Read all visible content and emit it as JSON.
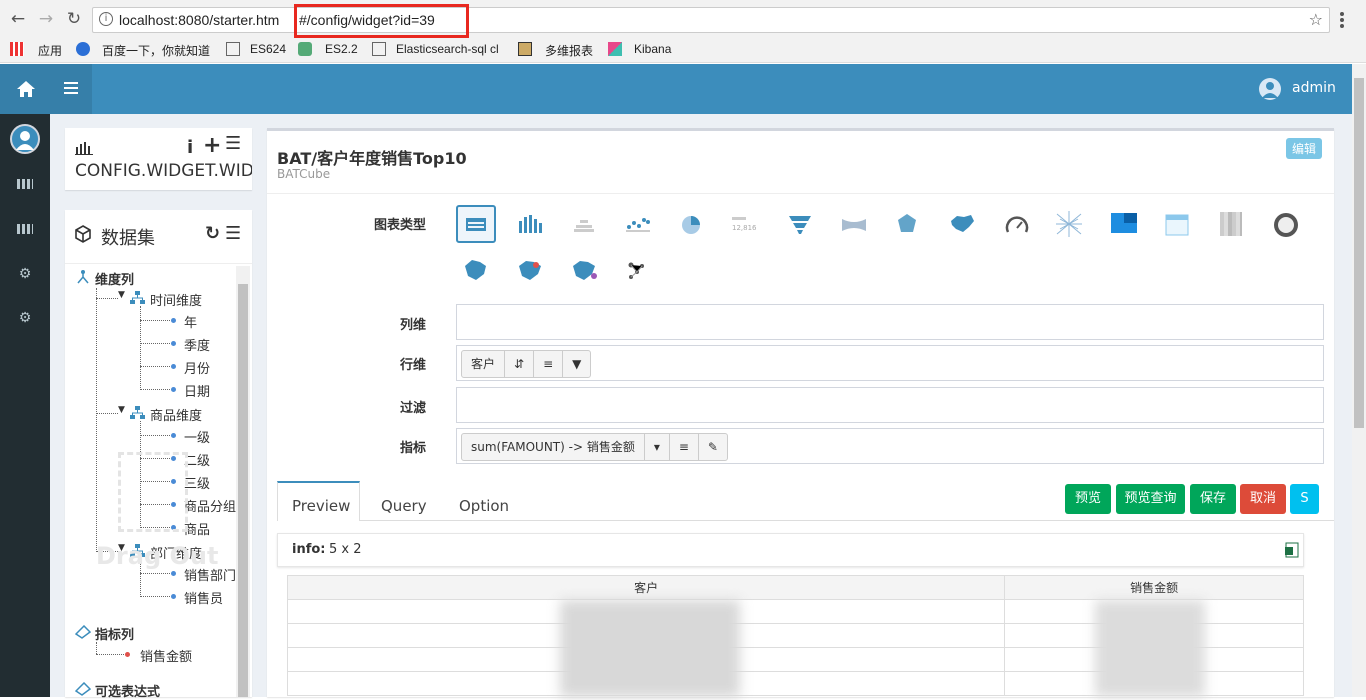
{
  "browser": {
    "url_host_path": "localhost:8080/starter.htm",
    "url_hash": "#/config/widget?id=39",
    "bookmarks": [
      "应用",
      "百度一下，你就知道",
      "ES624",
      "ES2.2",
      "Elasticsearch-sql cl",
      "多维报表",
      "Kibana"
    ]
  },
  "header": {
    "user": "admin"
  },
  "widget_list_box": {
    "title": "CONFIG.WIDGET.WIDG"
  },
  "dataset_box": {
    "title": "数据集",
    "dimension_header": "维度列",
    "groups": [
      {
        "label": "时间维度",
        "items": [
          "年",
          "季度",
          "月份",
          "日期"
        ]
      },
      {
        "label": "商品维度",
        "items": [
          "一级",
          "二级",
          "三级",
          "商品分组",
          "商品"
        ]
      },
      {
        "label": "部门维度",
        "items": [
          "销售部门",
          "销售员"
        ]
      }
    ],
    "measure_header": "指标列",
    "measures": [
      "销售金额"
    ],
    "expression_header": "可选表达式",
    "drag_hint": "Drag Out"
  },
  "editor": {
    "title": "BAT/客户年度销售Top10",
    "subtitle": "BATCube",
    "edit_badge": "编辑",
    "chart_type_label": "图表类型",
    "chart_types": [
      "table-chart-icon",
      "bar-chart-icon",
      "stacked-bar-icon",
      "scatter-icon",
      "pie-icon",
      "kpi-icon",
      "funnel-icon",
      "sankey-icon",
      "radar-icon",
      "china-map-icon",
      "gauge-icon",
      "word-cloud-icon",
      "heatmap-icon",
      "calendar-icon",
      "treemap-icon",
      "liquid-fill-icon",
      "area-map-icon",
      "scatter-map-icon",
      "heat-map-geo-icon",
      "relation-icon"
    ],
    "column_label": "列维",
    "row_label": "行维",
    "row_chip": "客户",
    "filter_label": "过滤",
    "measure_label": "指标",
    "measure_chip": "sum(FAMOUNT) -> 销售金额",
    "tabs": [
      "Preview",
      "Query",
      "Option"
    ],
    "buttons": {
      "preview": "预览",
      "preview_query": "预览查询",
      "save": "保存",
      "cancel": "取消",
      "s": "S"
    },
    "info_label": "info:",
    "info_value": "5 x 2",
    "table_headers": [
      "客户",
      "销售金额"
    ]
  },
  "colors": {
    "topnav": "#3c8dbc",
    "sidebar": "#222d32",
    "btn_green": "#00a65a",
    "btn_red": "#dd4b39",
    "btn_blue": "#00c0ef",
    "highlight": "#e8281f"
  }
}
